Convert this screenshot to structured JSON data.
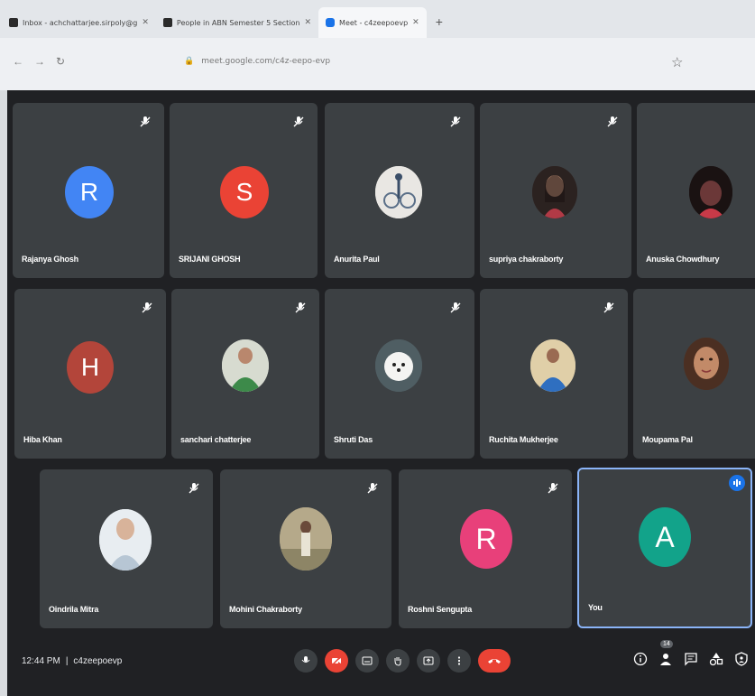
{
  "browser": {
    "tabs": [
      {
        "label": "Inbox - achchattarjee.sirpoly@g",
        "active": false
      },
      {
        "label": "People in ABN Semester 5 Section",
        "active": false
      },
      {
        "label": "Meet - c4zeepoevp",
        "active": true
      }
    ],
    "address": "meet.google.com/c4z-eepo-evp"
  },
  "participants": [
    {
      "name": "Rajanya Ghosh",
      "initial": "R",
      "color": "#4285f4",
      "type": "initial"
    },
    {
      "name": "SRIJANI GHOSH",
      "initial": "S",
      "color": "#ea4335",
      "type": "initial"
    },
    {
      "name": "Anurita Paul",
      "type": "photo",
      "photo": "bike"
    },
    {
      "name": "supriya chakraborty",
      "type": "photo",
      "photo": "portrait-dark"
    },
    {
      "name": "Anuska Chowdhury",
      "type": "photo",
      "photo": "portrait-red"
    },
    {
      "name": "Hiba Khan",
      "initial": "H",
      "color": "#b3453a",
      "type": "initial"
    },
    {
      "name": "sanchari chatterjee",
      "type": "photo",
      "photo": "portrait-green"
    },
    {
      "name": "Shruti Das",
      "type": "photo",
      "photo": "dog"
    },
    {
      "name": "Ruchita Mukherjee",
      "type": "photo",
      "photo": "portrait-blue"
    },
    {
      "name": "Moupama Pal",
      "type": "photo",
      "photo": "face"
    },
    {
      "name": "Oindrila Mitra",
      "type": "photo",
      "photo": "portrait-light"
    },
    {
      "name": "Mohini Chakraborty",
      "type": "photo",
      "photo": "outdoor"
    },
    {
      "name": "Roshni Sengupta",
      "initial": "R",
      "color": "#e8407a",
      "type": "initial"
    },
    {
      "name": "You",
      "initial": "A",
      "color": "#12a38a",
      "type": "initial"
    }
  ],
  "meeting": {
    "time": "12:44 PM",
    "separator": "|",
    "code": "c4zeepoevp",
    "participant_count": "14"
  },
  "colors": {
    "background": "#202124",
    "tile": "#3c4043",
    "end_call": "#ea4335",
    "accent": "#1a73e8"
  }
}
